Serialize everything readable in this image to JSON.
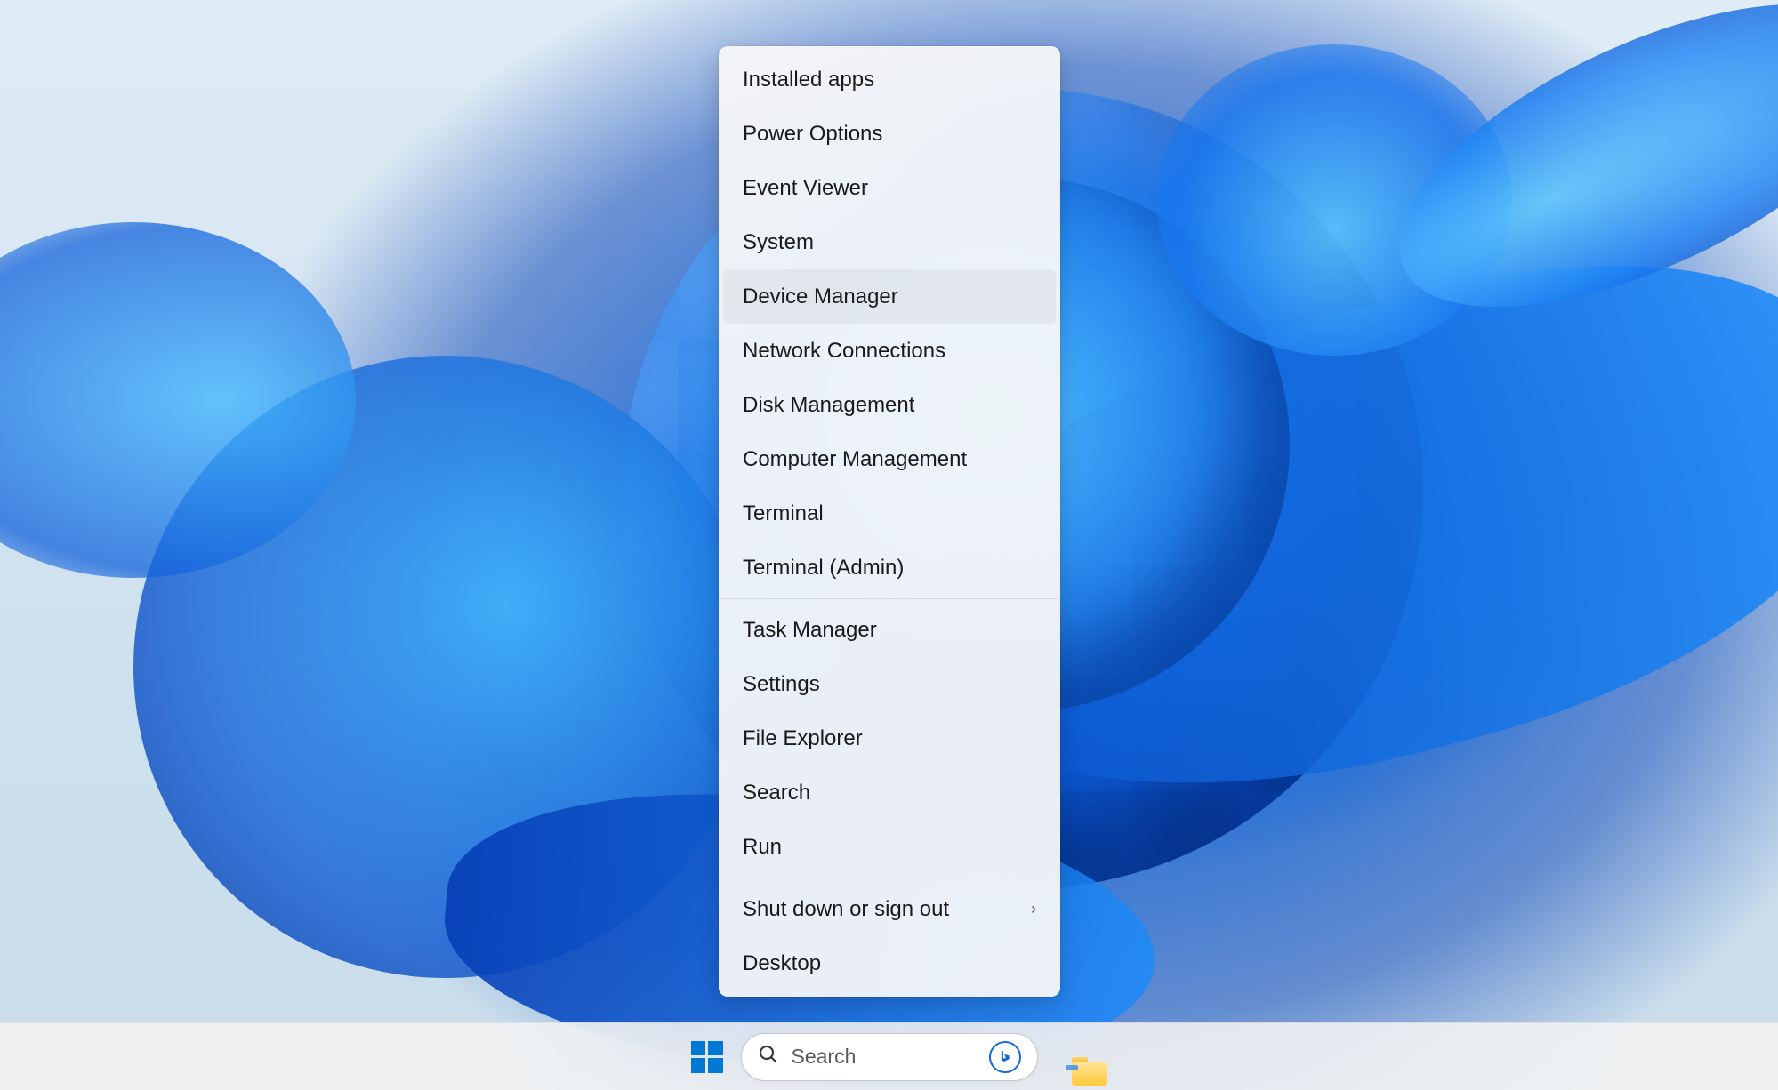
{
  "context_menu": {
    "groups": [
      [
        {
          "id": "installed-apps",
          "label": "Installed apps",
          "hovered": false,
          "submenu": false
        },
        {
          "id": "power-options",
          "label": "Power Options",
          "hovered": false,
          "submenu": false
        },
        {
          "id": "event-viewer",
          "label": "Event Viewer",
          "hovered": false,
          "submenu": false
        },
        {
          "id": "system",
          "label": "System",
          "hovered": false,
          "submenu": false
        },
        {
          "id": "device-manager",
          "label": "Device Manager",
          "hovered": true,
          "submenu": false
        },
        {
          "id": "network-connections",
          "label": "Network Connections",
          "hovered": false,
          "submenu": false
        },
        {
          "id": "disk-management",
          "label": "Disk Management",
          "hovered": false,
          "submenu": false
        },
        {
          "id": "computer-management",
          "label": "Computer Management",
          "hovered": false,
          "submenu": false
        },
        {
          "id": "terminal",
          "label": "Terminal",
          "hovered": false,
          "submenu": false
        },
        {
          "id": "terminal-admin",
          "label": "Terminal (Admin)",
          "hovered": false,
          "submenu": false
        }
      ],
      [
        {
          "id": "task-manager",
          "label": "Task Manager",
          "hovered": false,
          "submenu": false
        },
        {
          "id": "settings",
          "label": "Settings",
          "hovered": false,
          "submenu": false
        },
        {
          "id": "file-explorer",
          "label": "File Explorer",
          "hovered": false,
          "submenu": false
        },
        {
          "id": "search",
          "label": "Search",
          "hovered": false,
          "submenu": false
        },
        {
          "id": "run",
          "label": "Run",
          "hovered": false,
          "submenu": false
        }
      ],
      [
        {
          "id": "shut-down",
          "label": "Shut down or sign out",
          "hovered": false,
          "submenu": true
        },
        {
          "id": "desktop",
          "label": "Desktop",
          "hovered": false,
          "submenu": false
        }
      ]
    ]
  },
  "taskbar": {
    "search_placeholder": "Search"
  }
}
